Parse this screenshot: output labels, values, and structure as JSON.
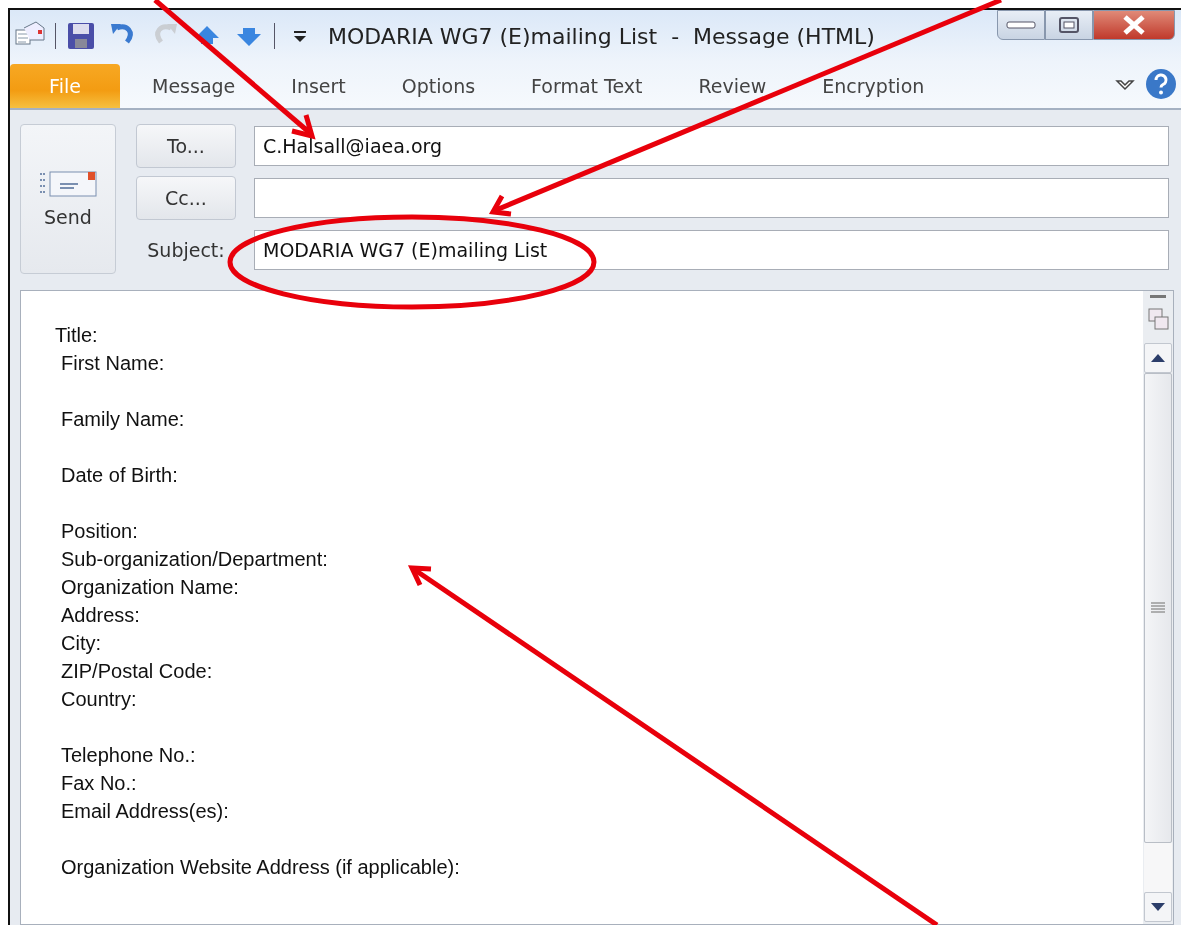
{
  "window": {
    "title": "MODARIA WG7 (E)mailing List  -  Message (HTML)"
  },
  "quick_access": [
    {
      "kind": "app",
      "disabled": false
    },
    {
      "kind": "save",
      "disabled": false
    },
    {
      "kind": "undo",
      "disabled": false
    },
    {
      "kind": "redo",
      "disabled": true
    },
    {
      "kind": "up",
      "disabled": false
    },
    {
      "kind": "down",
      "disabled": false
    },
    {
      "kind": "customize",
      "disabled": false
    }
  ],
  "ribbon_tabs": [
    {
      "label": "File",
      "kind": "file",
      "selected": false
    },
    {
      "label": "Message",
      "kind": "tab",
      "selected": false
    },
    {
      "label": "Insert",
      "kind": "tab",
      "selected": false
    },
    {
      "label": "Options",
      "kind": "tab",
      "selected": false
    },
    {
      "label": "Format Text",
      "kind": "tab",
      "selected": false
    },
    {
      "label": "Review",
      "kind": "tab",
      "selected": false
    },
    {
      "label": "Encryption",
      "kind": "tab",
      "selected": false
    }
  ],
  "send_button": {
    "label": "Send"
  },
  "to": {
    "button": "To...",
    "value": "C.Halsall@iaea.org"
  },
  "cc": {
    "button": "Cc..."
  },
  "subject": {
    "label": "Subject:",
    "value": "MODARIA WG7 (E)mailing List"
  },
  "body": {
    "paragraphs": [
      [
        "Title:",
        "First Name:"
      ],
      [
        "Family Name:"
      ],
      [
        "Date of Birth:"
      ],
      [
        "Position:",
        "Sub-organization/Department:",
        "Organization Name:",
        "Address:",
        "City:",
        "ZIP/Postal Code:",
        "Country:"
      ],
      [
        "Telephone No.:",
        "Fax No.:",
        "Email Address(es):"
      ],
      [
        "Organization Website Address (if applicable):"
      ]
    ]
  }
}
